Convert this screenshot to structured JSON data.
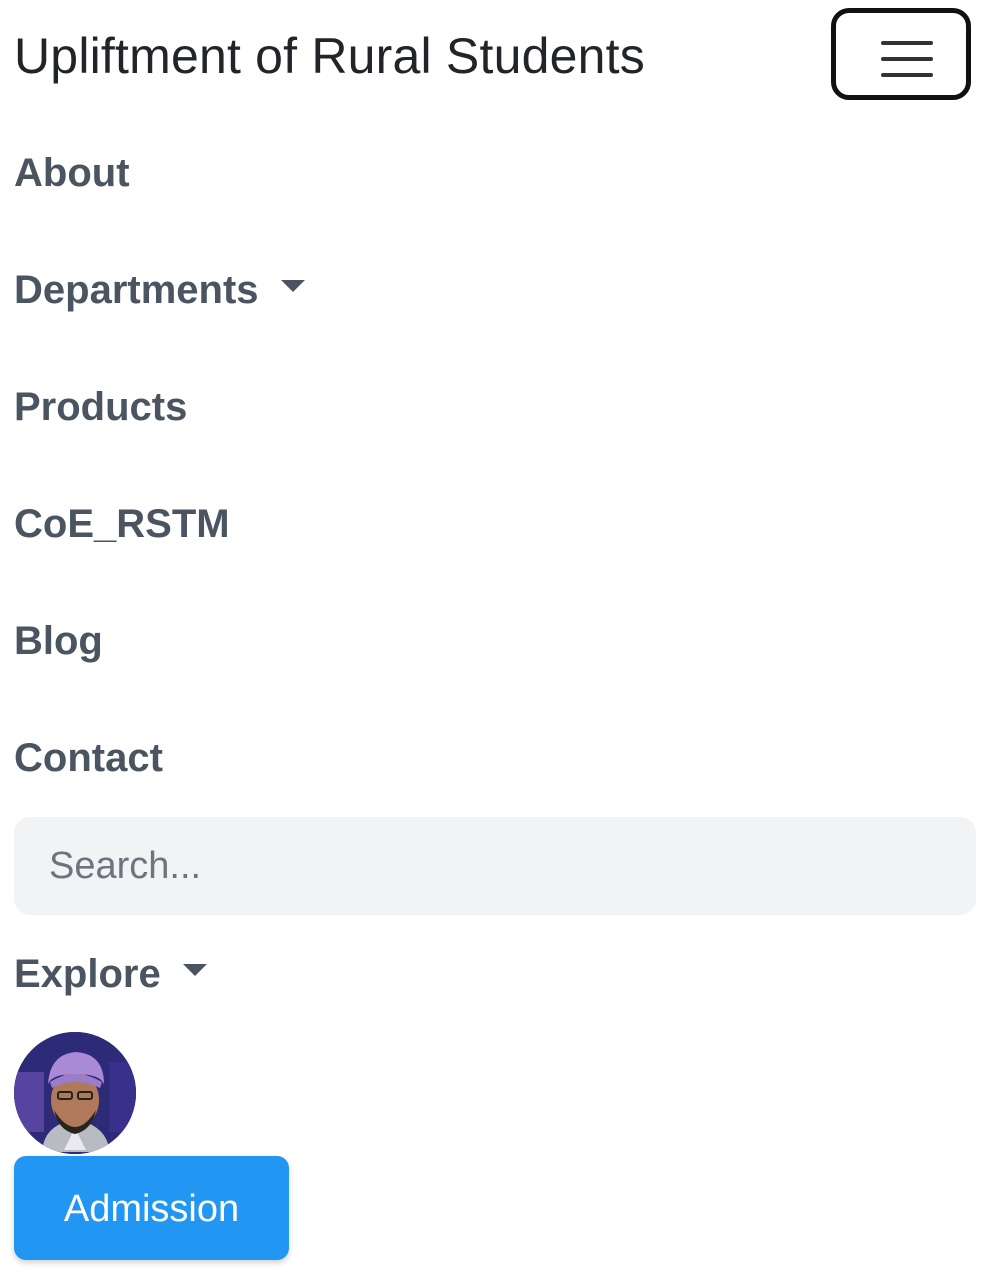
{
  "navbar": {
    "brand": "Upliftment of Rural Students",
    "toggler_icon": "hamburger-menu-icon"
  },
  "nav": {
    "items": [
      {
        "label": "About"
      },
      {
        "label": "Departments",
        "has_dropdown": true
      },
      {
        "label": "Products"
      },
      {
        "label": "CoE_RSTM"
      },
      {
        "label": "Blog"
      },
      {
        "label": "Contact"
      }
    ]
  },
  "search": {
    "placeholder": "Search..."
  },
  "explore": {
    "label": "Explore",
    "has_dropdown": true
  },
  "profile": {
    "avatar_icon": "user-avatar"
  },
  "admission": {
    "label": "Admission"
  },
  "colors": {
    "nav_text": "#4a5561",
    "button_primary": "#2196f3",
    "search_bg": "#f1f3f5"
  }
}
